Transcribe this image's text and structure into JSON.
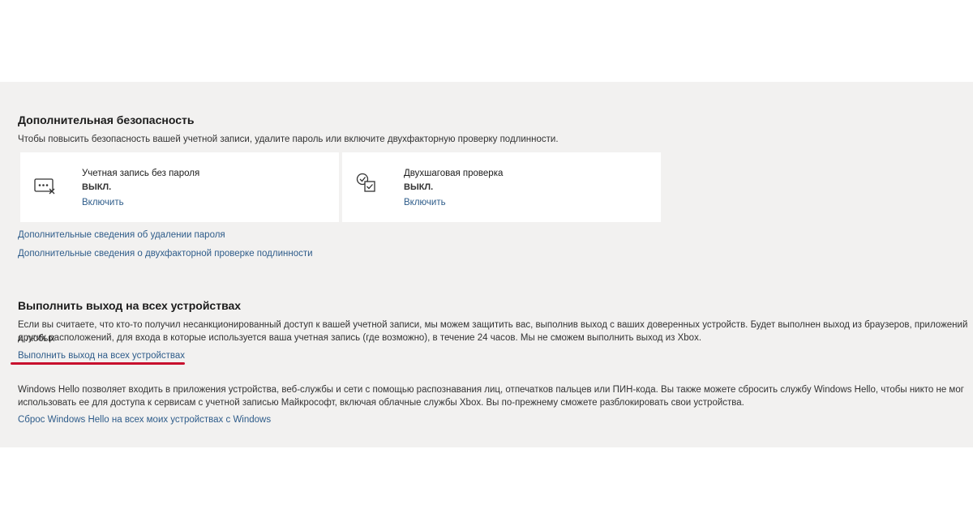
{
  "security": {
    "heading": "Дополнительная безопасность",
    "description": "Чтобы повысить безопасность вашей учетной записи, удалите пароль или включите двухфакторную проверку подлинности.",
    "cards": [
      {
        "icon": "passwordless-icon",
        "title": "Учетная запись без пароля",
        "status": "ВЫКЛ.",
        "action": "Включить"
      },
      {
        "icon": "two-step-verification-icon",
        "title": "Двухшаговая проверка",
        "status": "ВЫКЛ.",
        "action": "Включить"
      }
    ],
    "link_password": "Дополнительные сведения об удалении пароля",
    "link_twofactor": "Дополнительные сведения о двухфакторной проверке подлинности"
  },
  "signout": {
    "heading": "Выполнить выход на всех устройствах",
    "description_line1": "Если вы считаете, что кто-то получил несанкционированный доступ к вашей учетной записи, мы можем защитить вас, выполнив выход с ваших доверенных устройств. Будет выполнен выход из браузеров, приложений и любых",
    "description_line2": "других расположений, для входа в которые используется ваша учетная запись (где возможно), в течение 24 часов. Мы не сможем выполнить выход из Xbox.",
    "link": "Выполнить выход на всех устройствах"
  },
  "hello": {
    "description_line1": "Windows Hello позволяет входить в приложения устройства, веб-службы и сети с помощью распознавания лиц, отпечатков пальцев или ПИН-кода. Вы также можете сбросить службу Windows Hello, чтобы никто не мог",
    "description_line2": "использовать ее для доступа к сервисам с учетной записью Майкрософт, включая облачные службы Xbox. Вы по-прежнему сможете разблокировать свои устройства.",
    "link": "Сброс Windows Hello на всех моих устройствах с Windows"
  },
  "colors": {
    "panel_bg": "#f2f1f0",
    "link": "#2e5c8a",
    "highlight_underline": "#c8102e"
  }
}
